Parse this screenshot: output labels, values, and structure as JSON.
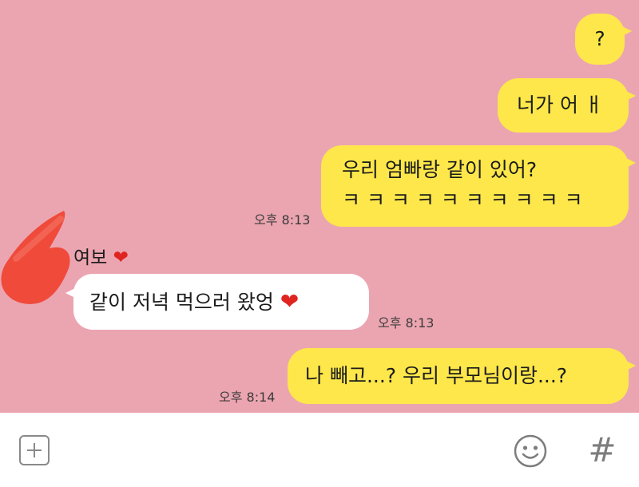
{
  "messages": {
    "m1": {
      "text": "?"
    },
    "m2": {
      "text": "너가 어 ㅐ"
    },
    "m3": {
      "line1": "우리 엄빠랑 같이 있어?",
      "line2": "ㅋ ㅋ ㅋ ㅋ ㅋ ㅋ ㅋ ㅋ ㅋ ㅋ"
    },
    "m3_time": "오후 8:13",
    "m4": {
      "sender": "여보",
      "text": "같이 저녁 먹으러 왔엉"
    },
    "m4_time": "오후 8:13",
    "m5": {
      "text": "나 빼고...? 우리 부모님이랑...?"
    },
    "m5_time": "오후 8:14"
  },
  "toolbar": {
    "add_icon": "plus-square-icon",
    "emoji_icon": "smiley-icon",
    "hashtag_label": "#"
  },
  "colors": {
    "chat_background": "#eba5b1",
    "my_bubble": "#fde74a",
    "their_bubble": "#ffffff",
    "heart": "#e0241f"
  }
}
